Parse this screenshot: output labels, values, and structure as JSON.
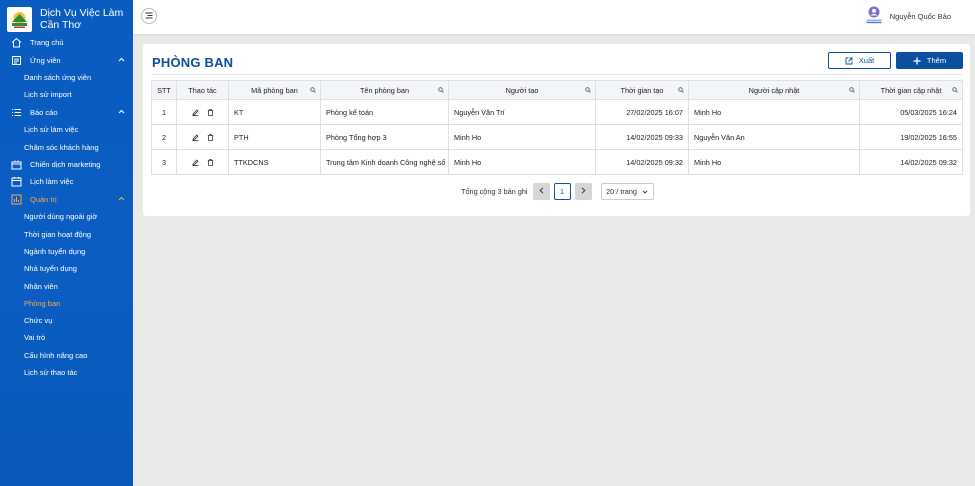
{
  "brand": {
    "line1": "Dịch Vụ Việc Làm",
    "line2": "Cần Thơ",
    "logo_icon": "brand-logo"
  },
  "sidebar": {
    "items": [
      {
        "label": "Trang chủ",
        "icon": "home-icon"
      },
      {
        "label": "Ứng viên",
        "icon": "candidate-icon",
        "expanded": true,
        "children": [
          "Danh sách ứng viên",
          "Lịch sử import"
        ]
      },
      {
        "label": "Báo cáo",
        "icon": "report-icon",
        "expanded": true,
        "children": [
          "Lịch sử làm việc",
          "Chăm sóc khách hàng"
        ]
      },
      {
        "label": "Chiến dịch marketing",
        "icon": "campaign-icon"
      },
      {
        "label": "Lịch làm việc",
        "icon": "calendar-icon"
      },
      {
        "label": "Quản trị",
        "icon": "admin-icon",
        "expanded": true,
        "active": true,
        "children": [
          "Người dùng ngoài giờ",
          "Thời gian hoạt động",
          "Ngành tuyển dụng",
          "Nhà tuyển dụng",
          "Nhân viên",
          "Phòng ban",
          "Chức vụ",
          "Vai trò",
          "Cấu hình nâng cao",
          "Lịch sử thao tác"
        ],
        "active_child": "Phòng ban"
      }
    ]
  },
  "header": {
    "user_name": "Nguyễn Quốc Bảo"
  },
  "page": {
    "title": "PHÒNG BAN",
    "export_label": "Xuất",
    "add_label": "Thêm"
  },
  "table": {
    "columns": [
      "STT",
      "Thao tác",
      "Mã phòng ban",
      "Tên phòng ban",
      "Người tạo",
      "Thời gian tạo",
      "Người cập nhật",
      "Thời gian cập nhật"
    ],
    "rows": [
      {
        "stt": "1",
        "code": "KT",
        "name": "Phòng kế toán",
        "creator": "Nguyễn Văn Trí",
        "created": "27/02/2025 16:07",
        "updater": "Minh Ho",
        "updated": "05/03/2025 16:24"
      },
      {
        "stt": "2",
        "code": "PTH",
        "name": "Phòng Tổng hợp 3",
        "creator": "Minh Ho",
        "created": "14/02/2025 09:33",
        "updater": "Nguyễn Văn An",
        "updated": "19/02/2025 16:55"
      },
      {
        "stt": "3",
        "code": "TTKDCNS",
        "name": "Trung tâm Kinh doanh Công nghệ số",
        "creator": "Minh Ho",
        "created": "14/02/2025 09:32",
        "updater": "Minh Ho",
        "updated": "14/02/2025 09:32"
      }
    ]
  },
  "pagination": {
    "total_text": "Tổng cộng 3 bản ghi",
    "current_page": "1",
    "page_size": "20 / trang"
  },
  "colors": {
    "sidebar": "#0a5cc0",
    "primary": "#0b4fa0",
    "active_menu": "#f7a84a"
  }
}
